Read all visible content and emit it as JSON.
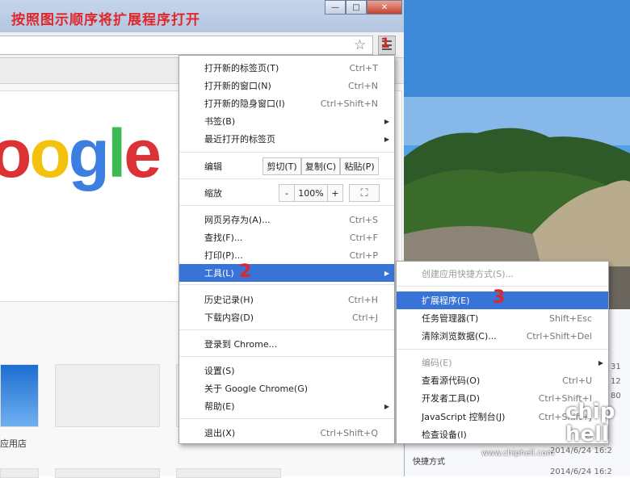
{
  "caption": "按照图示顺序将扩展程序打开",
  "steps": {
    "step1": "1",
    "step2": "2",
    "step3": "3"
  },
  "google": {
    "letters": [
      "o",
      "o",
      "g",
      "l",
      "e"
    ],
    "colors": [
      "#db3236",
      "#f4c20d",
      "#3c7fe0",
      "#3cba54",
      "#db3236"
    ]
  },
  "apps_label": "应用店",
  "window_buttons": {
    "minimize": "—",
    "maximize": "□",
    "close": "✕"
  },
  "main_menu": {
    "new_tab": {
      "label": "打开新的标签页(T)",
      "shortcut": "Ctrl+T"
    },
    "new_window": {
      "label": "打开新的窗口(N)",
      "shortcut": "Ctrl+N"
    },
    "incognito": {
      "label": "打开新的隐身窗口(I)",
      "shortcut": "Ctrl+Shift+N"
    },
    "bookmarks": {
      "label": "书签(B)"
    },
    "recent_tabs": {
      "label": "最近打开的标签页"
    },
    "edit": {
      "label": "编辑",
      "cut": "剪切(T)",
      "copy": "复制(C)",
      "paste": "粘贴(P)"
    },
    "zoom": {
      "label": "缩放",
      "minus": "-",
      "value": "100%",
      "plus": "+"
    },
    "save_as": {
      "label": "网页另存为(A)...",
      "shortcut": "Ctrl+S"
    },
    "find": {
      "label": "查找(F)...",
      "shortcut": "Ctrl+F"
    },
    "print": {
      "label": "打印(P)...",
      "shortcut": "Ctrl+P"
    },
    "tools": {
      "label": "工具(L)"
    },
    "history": {
      "label": "历史记录(H)",
      "shortcut": "Ctrl+H"
    },
    "downloads": {
      "label": "下载内容(D)",
      "shortcut": "Ctrl+J"
    },
    "sign_in": {
      "label": "登录到 Chrome..."
    },
    "settings": {
      "label": "设置(S)"
    },
    "about": {
      "label": "关于 Google Chrome(G)"
    },
    "help": {
      "label": "帮助(E)"
    },
    "exit": {
      "label": "退出(X)",
      "shortcut": "Ctrl+Shift+Q"
    }
  },
  "tools_menu": {
    "create_shortcut": {
      "label": "创建应用快捷方式(S)..."
    },
    "extensions": {
      "label": "扩展程序(E)"
    },
    "task_manager": {
      "label": "任务管理器(T)",
      "shortcut": "Shift+Esc"
    },
    "clear_data": {
      "label": "清除浏览数据(C)...",
      "shortcut": "Ctrl+Shift+Del"
    },
    "encoding": {
      "label": "编码(E)"
    },
    "view_source": {
      "label": "查看源代码(O)",
      "shortcut": "Ctrl+U"
    },
    "dev_tools": {
      "label": "开发者工具(D)",
      "shortcut": "Ctrl+Shift+I"
    },
    "js_console": {
      "label": "JavaScript 控制台(J)",
      "shortcut": "Ctrl+Shift+J"
    },
    "inspect_devices": {
      "label": "检查设备(I)"
    }
  },
  "explorer": {
    "shortcut_label": "快捷方式",
    "date1": "2014/6/24 16:2",
    "date2": "2014/6/24 16:2",
    "num1": "31",
    "num2": "12",
    "num3": "80"
  },
  "watermark": "www.chiphell.com",
  "logo_text": "chip hell"
}
